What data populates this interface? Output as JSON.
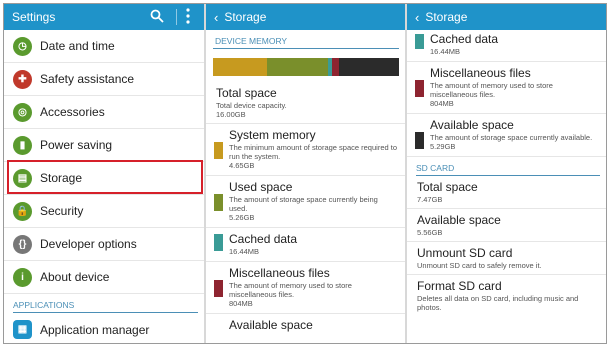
{
  "colors": {
    "accent": "#1f93c9",
    "system": "#c79a1f",
    "used": "#7a8f2b",
    "cached": "#3a9b96",
    "misc": "#8e2430",
    "available": "#2b2b2b",
    "highlight": "#d6202a"
  },
  "settings": {
    "title": "Settings",
    "items": [
      {
        "label": "Date and time",
        "icon": "clock-icon",
        "color": "#5a9a2e"
      },
      {
        "label": "Safety assistance",
        "icon": "alert-icon",
        "color": "#c0392b"
      },
      {
        "label": "Accessories",
        "icon": "accessories-icon",
        "color": "#5a9a2e"
      },
      {
        "label": "Power saving",
        "icon": "battery-icon",
        "color": "#5a9a2e"
      },
      {
        "label": "Storage",
        "icon": "storage-icon",
        "color": "#5a9a2e"
      },
      {
        "label": "Security",
        "icon": "lock-icon",
        "color": "#5a9a2e"
      },
      {
        "label": "Developer options",
        "icon": "braces-icon",
        "color": "#777777"
      },
      {
        "label": "About device",
        "icon": "info-icon",
        "color": "#5a9a2e"
      }
    ],
    "section": "APPLICATIONS",
    "app_manager": {
      "label": "Application manager",
      "icon": "grid-icon",
      "color": "#1f93c9"
    }
  },
  "storage_left": {
    "title": "Storage",
    "section": "DEVICE MEMORY",
    "usage_bar": [
      {
        "name": "system",
        "fraction": 0.29,
        "color": "#c79a1f"
      },
      {
        "name": "used",
        "fraction": 0.33,
        "color": "#7a8f2b"
      },
      {
        "name": "cached",
        "fraction": 0.02,
        "color": "#3a9b96"
      },
      {
        "name": "misc",
        "fraction": 0.04,
        "color": "#8e2430"
      },
      {
        "name": "available",
        "fraction": 0.32,
        "color": "#2b2b2b"
      }
    ],
    "total": {
      "title": "Total space",
      "desc": "Total device capacity.",
      "value": "16.00GB"
    },
    "system": {
      "title": "System memory",
      "desc": "The minimum amount of storage space required to run the system.",
      "value": "4.65GB"
    },
    "used": {
      "title": "Used space",
      "desc": "The amount of storage space currently being used.",
      "value": "5.26GB"
    },
    "cached": {
      "title": "Cached data",
      "value": "16.44MB"
    },
    "misc": {
      "title": "Miscellaneous files",
      "desc": "The amount of memory used to store miscellaneous files.",
      "value": "804MB"
    },
    "available_partial": "Available space"
  },
  "storage_right": {
    "title": "Storage",
    "cached": {
      "title": "Cached data",
      "value": "16.44MB"
    },
    "misc": {
      "title": "Miscellaneous files",
      "desc": "The amount of memory used to store miscellaneous files.",
      "value": "804MB"
    },
    "available": {
      "title": "Available space",
      "desc": "The amount of storage space currently available.",
      "value": "5.29GB"
    },
    "section": "SD CARD",
    "sd_total": {
      "title": "Total space",
      "value": "7.47GB"
    },
    "sd_available": {
      "title": "Available space",
      "value": "5.56GB"
    },
    "unmount": {
      "title": "Unmount SD card",
      "desc": "Unmount SD card to safely remove it."
    },
    "format": {
      "title": "Format SD card",
      "desc": "Deletes all data on SD card, including music and photos."
    }
  }
}
